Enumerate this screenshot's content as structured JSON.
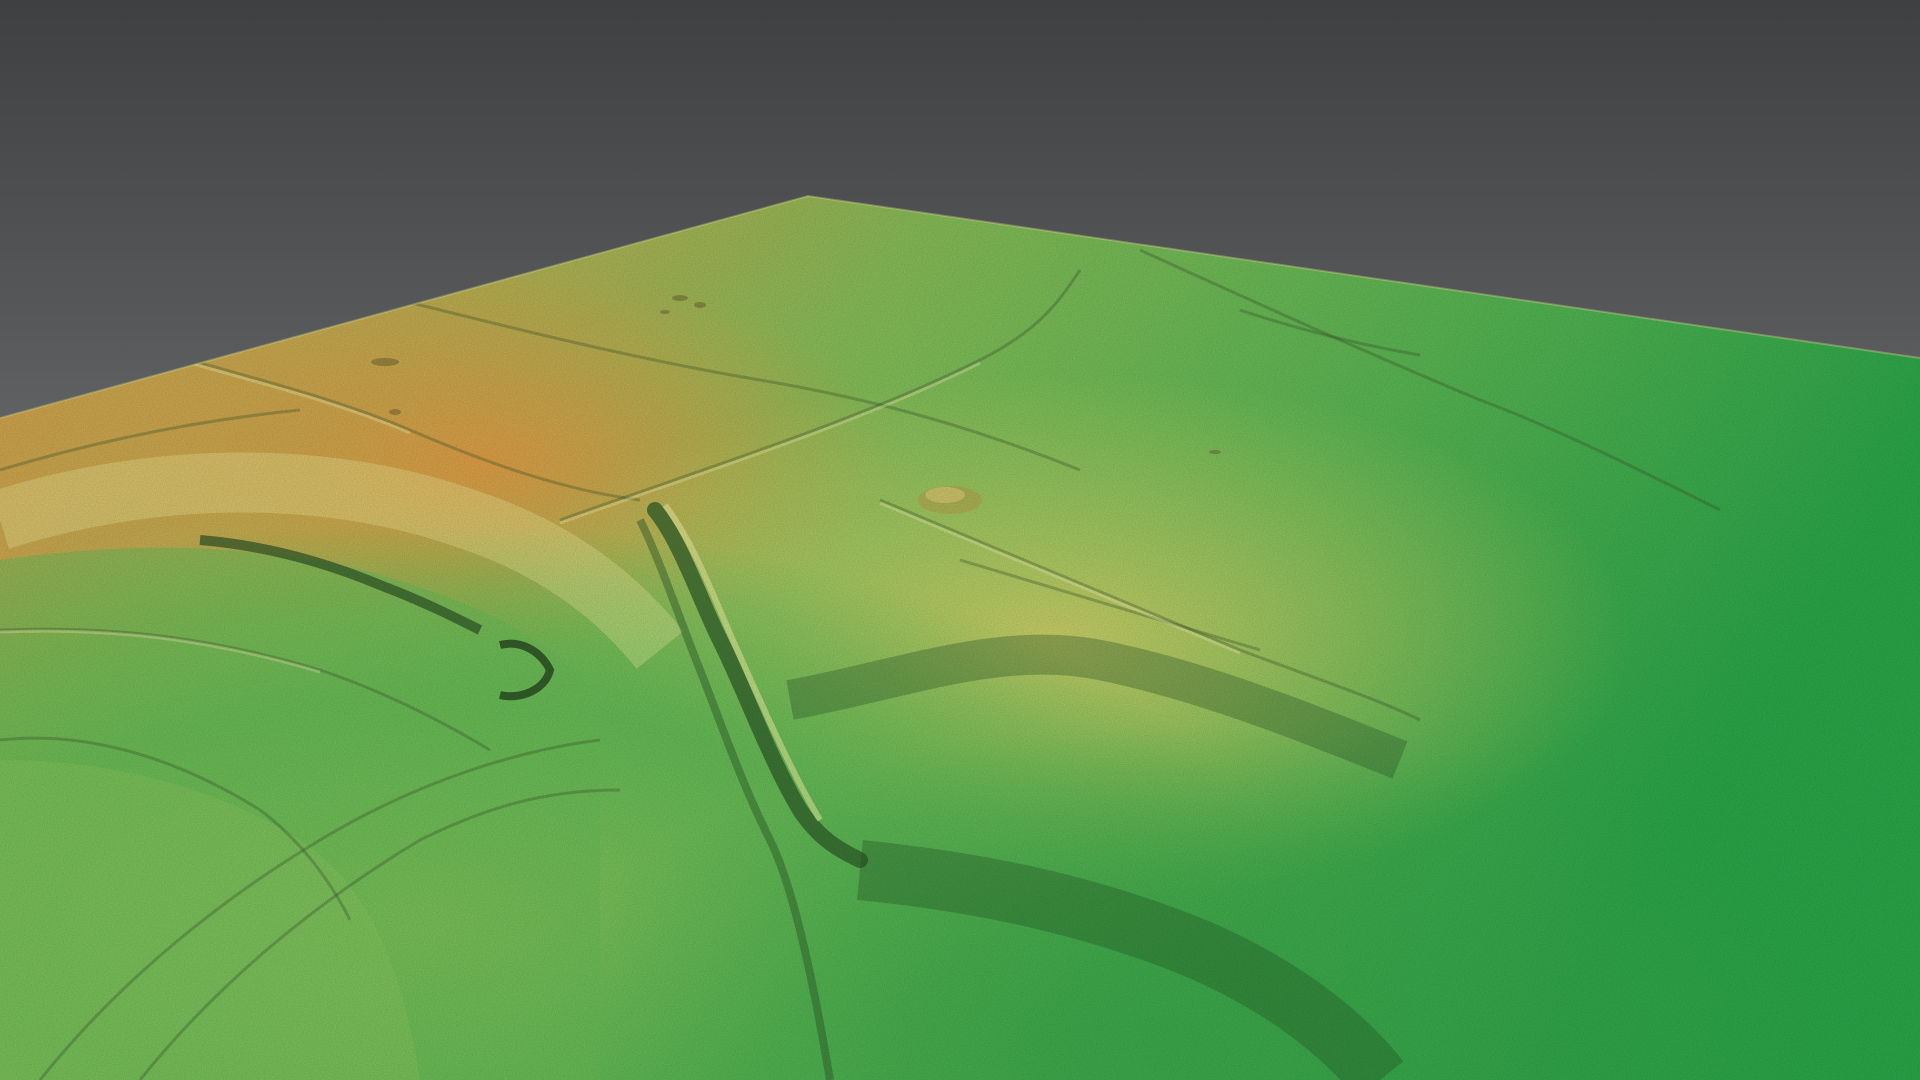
{
  "scene": {
    "type": "3D terrain elevation model (LiDAR hillshade)",
    "background_color": "#6a6c6e",
    "elevation_colormap": {
      "high": "#e0a24a",
      "mid_high": "#d9c760",
      "mid": "#b8d06a",
      "mid_low": "#7cc25a",
      "low": "#2aa84a"
    }
  }
}
